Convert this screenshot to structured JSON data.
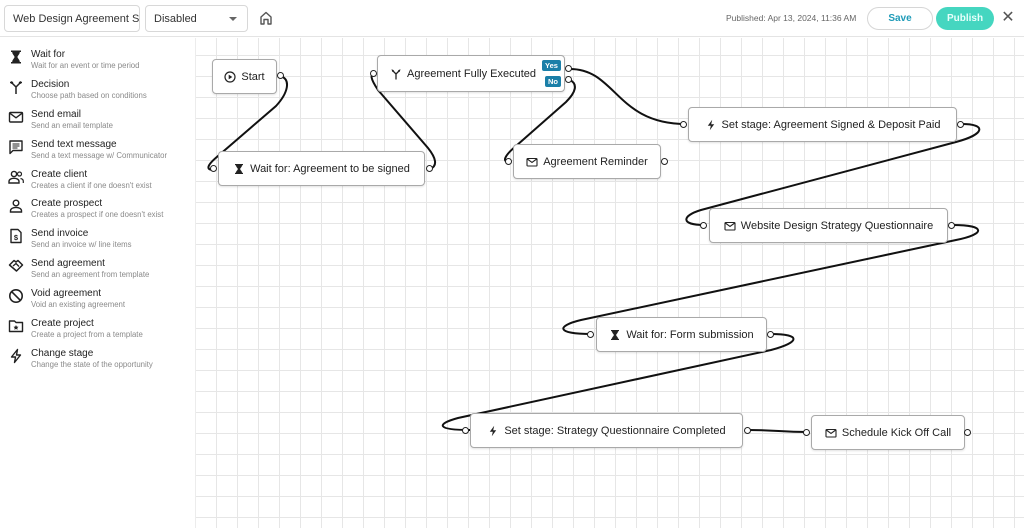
{
  "topbar": {
    "workflow_name": "Web Design Agreement Se",
    "status_value": "Disabled",
    "published_text": "Published: Apr 13, 2024, 11:36 AM",
    "save_label": "Save",
    "publish_label": "Publish",
    "close_glyph": "✕"
  },
  "sidebar": {
    "items": [
      {
        "title": "Wait for",
        "desc": "Wait for an event or time period",
        "icon": "hourglass-icon"
      },
      {
        "title": "Decision",
        "desc": "Choose path based on conditions",
        "icon": "decision-icon"
      },
      {
        "title": "Send email",
        "desc": "Send an email template",
        "icon": "email-icon"
      },
      {
        "title": "Send text message",
        "desc": "Send a text message w/ Communicator",
        "icon": "message-icon"
      },
      {
        "title": "Create client",
        "desc": "Creates a client if one doesn't exist",
        "icon": "client-icon"
      },
      {
        "title": "Create prospect",
        "desc": "Creates a prospect if one doesn't exist",
        "icon": "prospect-icon"
      },
      {
        "title": "Send invoice",
        "desc": "Send an invoice w/ line items",
        "icon": "invoice-icon"
      },
      {
        "title": "Send agreement",
        "desc": "Send an agreement from template",
        "icon": "agreement-icon"
      },
      {
        "title": "Void agreement",
        "desc": "Void an existing agreement",
        "icon": "void-icon"
      },
      {
        "title": "Create project",
        "desc": "Create a project from a template",
        "icon": "project-icon"
      },
      {
        "title": "Change stage",
        "desc": "Change the state of the opportunity",
        "icon": "lightning-icon"
      }
    ]
  },
  "workflow": {
    "nodes": [
      {
        "id": "start",
        "label": "Start",
        "icon": "play-icon"
      },
      {
        "id": "wait1",
        "label": "Wait for: Agreement to be signed",
        "icon": "hourglass-icon"
      },
      {
        "id": "decision",
        "label": "Agreement Fully Executed",
        "icon": "decision-icon"
      },
      {
        "id": "reminder",
        "label": "Agreement Reminder",
        "icon": "email-icon"
      },
      {
        "id": "stage1",
        "label": "Set stage: Agreement Signed & Deposit Paid",
        "icon": "lightning-icon"
      },
      {
        "id": "questionnaire",
        "label": "Website Design Strategy Questionnaire",
        "icon": "email-icon"
      },
      {
        "id": "wait2",
        "label": "Wait for: Form submission",
        "icon": "hourglass-icon"
      },
      {
        "id": "stage2",
        "label": "Set stage: Strategy Questionnaire Completed",
        "icon": "lightning-icon"
      },
      {
        "id": "kickoff",
        "label": "Schedule Kick Off Call",
        "icon": "email-icon"
      }
    ],
    "branch_labels": {
      "yes": "Yes",
      "no": "No"
    },
    "connections": [
      [
        "start",
        "wait1"
      ],
      [
        "wait1",
        "decision"
      ],
      [
        "decision:yes",
        "stage1"
      ],
      [
        "decision:no",
        "reminder"
      ],
      [
        "stage1",
        "questionnaire"
      ],
      [
        "questionnaire",
        "wait2"
      ],
      [
        "wait2",
        "stage2"
      ],
      [
        "stage2",
        "kickoff"
      ]
    ]
  },
  "colors": {
    "accent": "#1f9bb8",
    "publish": "#45d6c0",
    "branch_badge": "#1a7fa8"
  }
}
